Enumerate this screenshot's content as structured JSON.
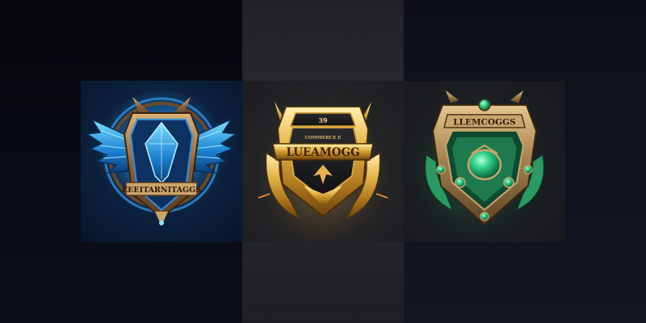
{
  "badges": [
    {
      "theme": "blue",
      "banner_text": "EEEITARNITAGGS",
      "accent": "#2fb0ff"
    },
    {
      "theme": "gold",
      "top_text": "39",
      "sub_text": "COMMERCE E",
      "banner_text": "LUEAMOGG",
      "accent": "#e6b84a"
    },
    {
      "theme": "green",
      "banner_text": "LLEMCOGGS",
      "accent": "#2fd28a"
    }
  ],
  "colors": {
    "blue": "#2fb0ff",
    "gold": "#e6b84a",
    "green": "#2fd28a",
    "bronze": "#a07a45"
  }
}
